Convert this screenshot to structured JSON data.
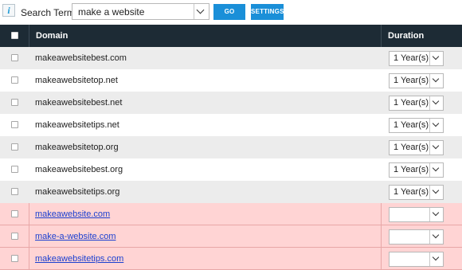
{
  "toolbar": {
    "info_glyph": "i",
    "search_label": "Search Term:",
    "search_value": "make a website",
    "go_label": "GO",
    "settings_label": "SETTINGS"
  },
  "table": {
    "headers": {
      "domain": "Domain",
      "duration": "Duration"
    },
    "available_rows": [
      {
        "domain": "makeawebsitebest.com",
        "duration": "1 Year(s)"
      },
      {
        "domain": "makeawebsitetop.net",
        "duration": "1 Year(s)"
      },
      {
        "domain": "makeawebsitebest.net",
        "duration": "1 Year(s)"
      },
      {
        "domain": "makeawebsitetips.net",
        "duration": "1 Year(s)"
      },
      {
        "domain": "makeawebsitetop.org",
        "duration": "1 Year(s)"
      },
      {
        "domain": "makeawebsitebest.org",
        "duration": "1 Year(s)"
      },
      {
        "domain": "makeawebsitetips.org",
        "duration": "1 Year(s)"
      }
    ],
    "taken_rows": [
      {
        "domain": "makeawebsite.com",
        "duration": ""
      },
      {
        "domain": "make-a-website.com",
        "duration": ""
      },
      {
        "domain": "makeawebsitetips.com",
        "duration": ""
      }
    ]
  },
  "colors": {
    "header_bg": "#1d2b35",
    "button_blue": "#1a8fd8",
    "row_alt": "#ececec",
    "taken_row": "#ffd4d4",
    "link": "#1a3fd0"
  }
}
